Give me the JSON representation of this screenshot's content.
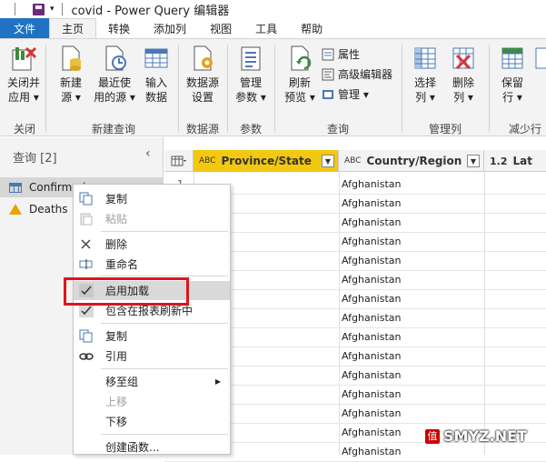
{
  "window": {
    "title": "covid - Power Query 编辑器"
  },
  "tabs": [
    "文件",
    "主页",
    "转换",
    "添加列",
    "视图",
    "工具",
    "帮助"
  ],
  "ribbon": {
    "close_apply": [
      "关闭并",
      "应用 ▾"
    ],
    "new_source": [
      "新建",
      "源 ▾"
    ],
    "recent_sources": [
      "最近使",
      "用的源 ▾"
    ],
    "enter_data": [
      "输入",
      "数据"
    ],
    "data_source_settings": [
      "数据源",
      "设置"
    ],
    "manage_params": [
      "管理",
      "参数 ▾"
    ],
    "refresh_preview": [
      "刷新",
      "预览 ▾"
    ],
    "properties": "属性",
    "advanced_editor": "高级编辑器",
    "manage": "管理 ▾",
    "choose_columns": [
      "选择",
      "列 ▾"
    ],
    "remove_columns": [
      "删除",
      "列 ▾"
    ],
    "keep_rows": [
      "保留",
      "行 ▾"
    ],
    "groups": {
      "close": "关闭",
      "new_query": "新建查询",
      "data_sources": "数据源",
      "parameters": "参数",
      "query": "查询",
      "manage_columns": "管理列",
      "reduce_rows": "减少行"
    }
  },
  "query_pane": {
    "title": "查询 [2]",
    "collapse": "‹",
    "items": [
      "Confirmed",
      "Deaths"
    ]
  },
  "grid": {
    "headers": [
      {
        "type": "ABC",
        "label": "Province/State"
      },
      {
        "type": "ABC",
        "label": "Country/Region"
      },
      {
        "type": "1.2",
        "label": "Lat"
      }
    ],
    "row_number": "1",
    "country_values": [
      "Afghanistan",
      "Afghanistan",
      "Afghanistan",
      "Afghanistan",
      "Afghanistan",
      "Afghanistan",
      "Afghanistan",
      "Afghanistan",
      "Afghanistan",
      "Afghanistan",
      "Afghanistan",
      "Afghanistan",
      "Afghanistan",
      "Afghanistan",
      "Afghanistan"
    ]
  },
  "context_menu": {
    "copy": "复制",
    "paste": "粘贴",
    "delete": "删除",
    "rename": "重命名",
    "enable_load": "启用加载",
    "include_refresh": "包含在报表刷新中",
    "duplicate": "复制",
    "reference": "引用",
    "move_to_group": "移至组",
    "move_up": "上移",
    "move_down": "下移",
    "create_function": "创建函数..."
  },
  "watermark": "SMYZ.NET",
  "watermark_icon": "值"
}
